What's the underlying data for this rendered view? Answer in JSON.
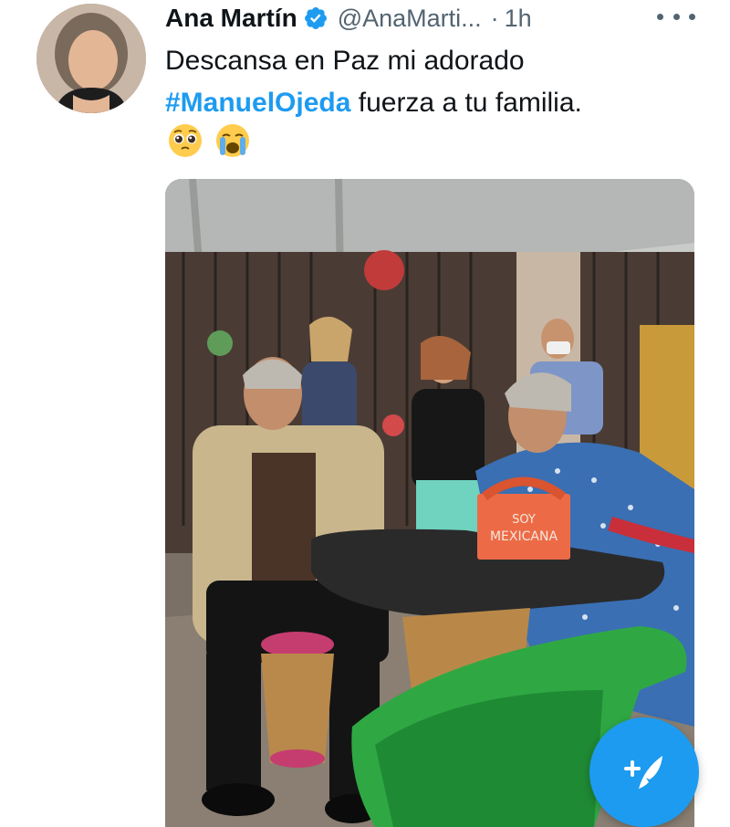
{
  "tweet": {
    "display_name": "Ana Martín",
    "handle": "@AnaMarti...",
    "separator": "·",
    "time": "1h",
    "text_before": "Descansa en Paz mi adorado",
    "hashtag": "#ManuelOjeda",
    "text_after": " fuerza a tu familia.",
    "emojis": [
      "pleading-face-emoji",
      "crying-face-emoji"
    ]
  },
  "photo": {
    "bag_text_line1": "SOY",
    "bag_text_line2": "MEXICANA"
  },
  "colors": {
    "accent": "#1d9bf0",
    "text": "#0f1419",
    "secondary_text": "#536471"
  },
  "icons": {
    "verified": "verified-badge-icon",
    "more": "more-options-icon",
    "compose": "compose-tweet-icon"
  }
}
